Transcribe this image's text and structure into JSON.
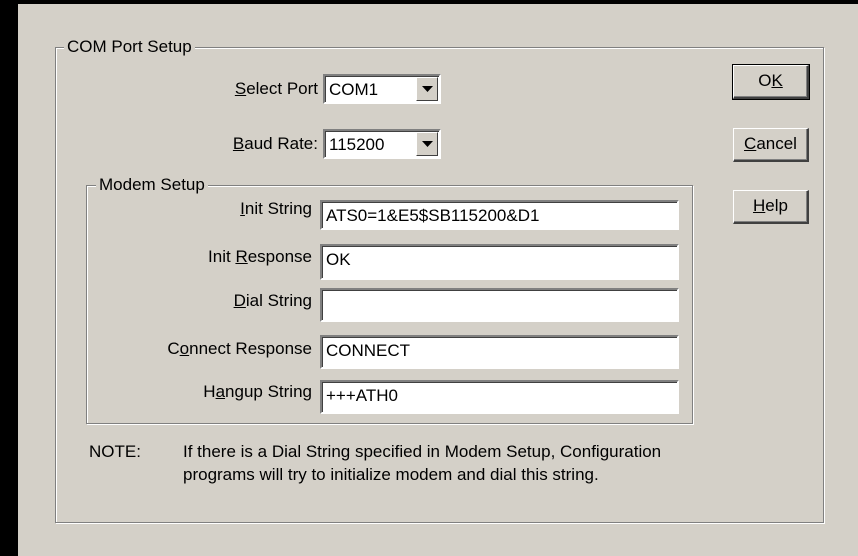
{
  "com_port_setup": {
    "title": "COM Port Setup",
    "select_port": {
      "pre": "",
      "key": "S",
      "post": "elect Port",
      "value": "COM1"
    },
    "baud_rate": {
      "pre": "",
      "key": "B",
      "post": "aud Rate:",
      "value": "115200"
    }
  },
  "modem_setup": {
    "title": "Modem Setup",
    "fields": [
      {
        "pre": "",
        "key": "I",
        "post": "nit String",
        "value": "ATS0=1&E5$SB115200&D1"
      },
      {
        "pre": "Init ",
        "key": "R",
        "post": "esponse",
        "value": "OK"
      },
      {
        "pre": "",
        "key": "D",
        "post": "ial String",
        "value": ""
      },
      {
        "pre": "C",
        "key": "o",
        "post": "nnect Response",
        "value": "CONNECT"
      },
      {
        "pre": "H",
        "key": "a",
        "post": "ngup String",
        "value": "+++ATH0"
      }
    ]
  },
  "buttons": {
    "ok": {
      "pre": "O",
      "key": "K",
      "post": ""
    },
    "cancel": {
      "pre": "",
      "key": "C",
      "post": "ancel"
    },
    "help": {
      "pre": "",
      "key": "H",
      "post": "elp"
    }
  },
  "note": {
    "label": "NOTE:",
    "line1": "If there is a Dial String specified in Modem Setup, Configuration",
    "line2": "programs will try to initialize modem and dial this string."
  },
  "icons": {
    "dropdown": "chevron-down-icon"
  },
  "colors": {
    "face": "#d4d0c8",
    "field": "#ffffff",
    "shadow": "#808080"
  }
}
